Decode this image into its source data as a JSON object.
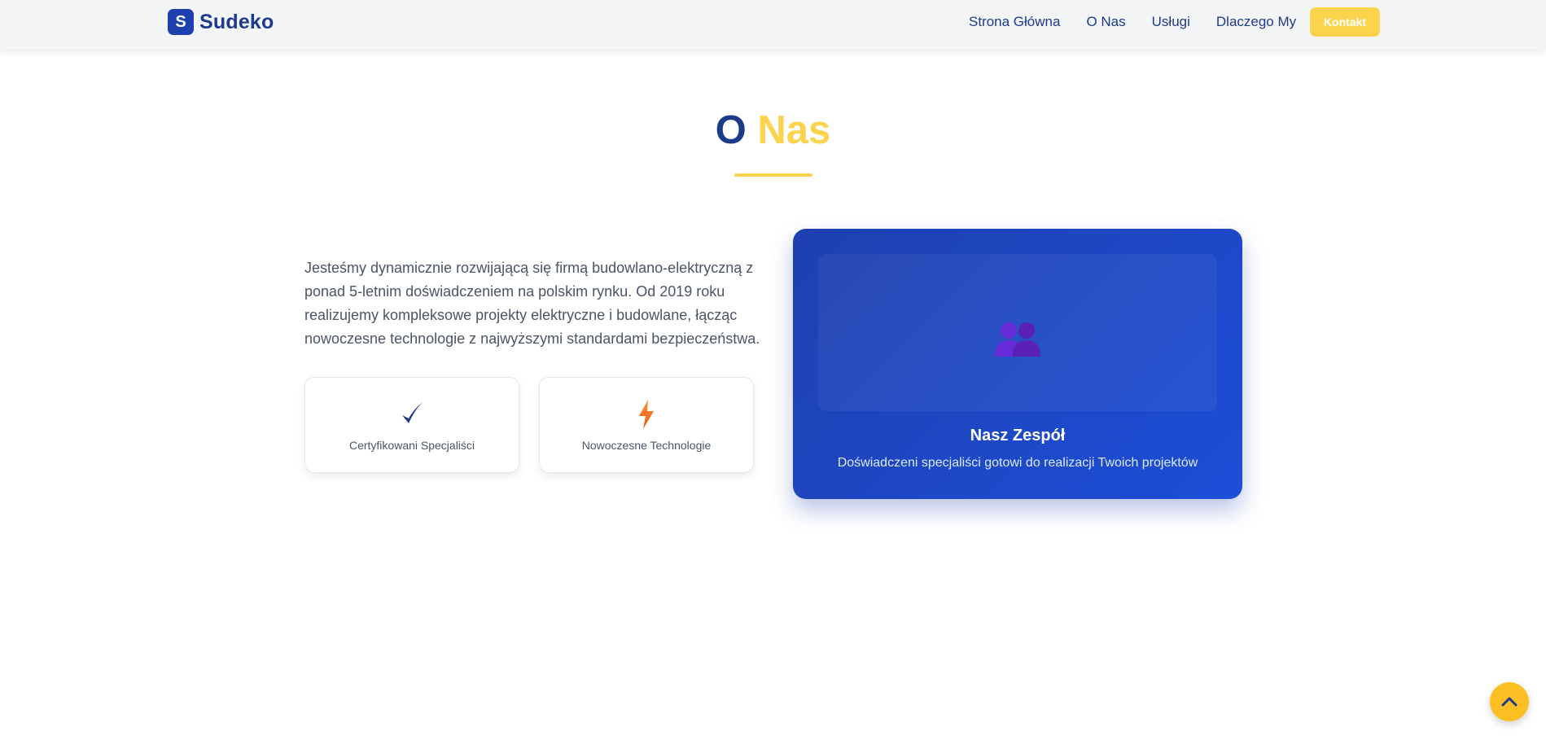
{
  "navbar": {
    "logo_letter": "S",
    "logo_text": "Sudeko",
    "links": [
      "Strona Główna",
      "O Nas",
      "Usługi",
      "Dlaczego My"
    ],
    "cta_label": "Kontakt"
  },
  "about": {
    "title_part1": "O",
    "title_part2": "Nas",
    "paragraph": "Jesteśmy dynamicznie rozwijającą się firmą budowlano-elektryczną z ponad 5-letnim doświadczeniem na polskim rynku. Od 2019 roku realizujemy kompleksowe projekty elektryczne i budowlane, łącząc nowoczesne technologie z najwyższymi standardami bezpieczeństwa.",
    "features": [
      {
        "icon": "checkmark-icon",
        "label": "Certyfikowani Specjaliści"
      },
      {
        "icon": "lightning-icon",
        "label": "Nowoczesne Technologie"
      }
    ],
    "team_card": {
      "icon": "people-icon",
      "title": "Nasz Zespół",
      "description": "Doświadczeni specjaliści gotowi do realizacji Twoich projektów"
    }
  },
  "scroll_top": {
    "icon": "chevron-up-icon"
  },
  "colors": {
    "primary": "#1e3a8a",
    "accent": "#fcd34d",
    "card_blue": "#1e40af"
  }
}
